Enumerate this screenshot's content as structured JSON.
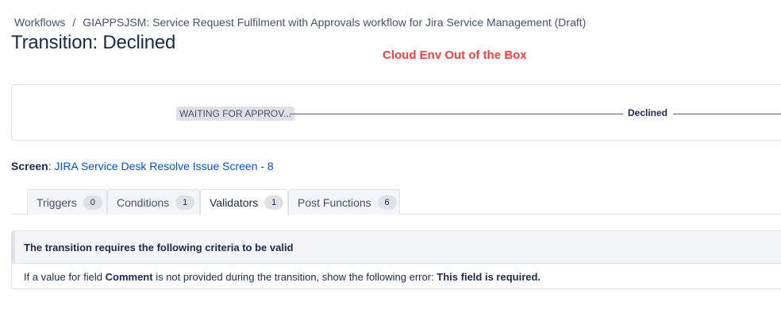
{
  "breadcrumb": {
    "root": "Workflows",
    "separator": "/",
    "current": "GIAPPSJSM: Service Request Fulfilment with Approvals workflow for Jira Service Management (Draft)"
  },
  "page_title": "Transition: Declined",
  "annotation": {
    "text": "Cloud Env Out of the Box",
    "color": "#ff3b3b"
  },
  "diagram": {
    "from_status": "WAITING FOR APPROV...",
    "transition_name": "Declined"
  },
  "screen": {
    "label": "Screen",
    "colon": ":",
    "link": "JIRA Service Desk Resolve Issue Screen - 8"
  },
  "tabs": [
    {
      "label": "Triggers",
      "count": "0",
      "active": false
    },
    {
      "label": "Conditions",
      "count": "1",
      "active": false
    },
    {
      "label": "Validators",
      "count": "1",
      "active": true
    },
    {
      "label": "Post Functions",
      "count": "6",
      "active": false
    }
  ],
  "validator_panel": {
    "header": "The transition requires the following criteria to be valid",
    "body_prefix": "If a value for field",
    "field_name": "Comment",
    "body_middle": "is not provided during the transition, show the following error:",
    "error_message": "This field is required."
  },
  "colors": {
    "link": "#0052cc",
    "text": "#172b4d",
    "border": "#dfe1e6"
  }
}
